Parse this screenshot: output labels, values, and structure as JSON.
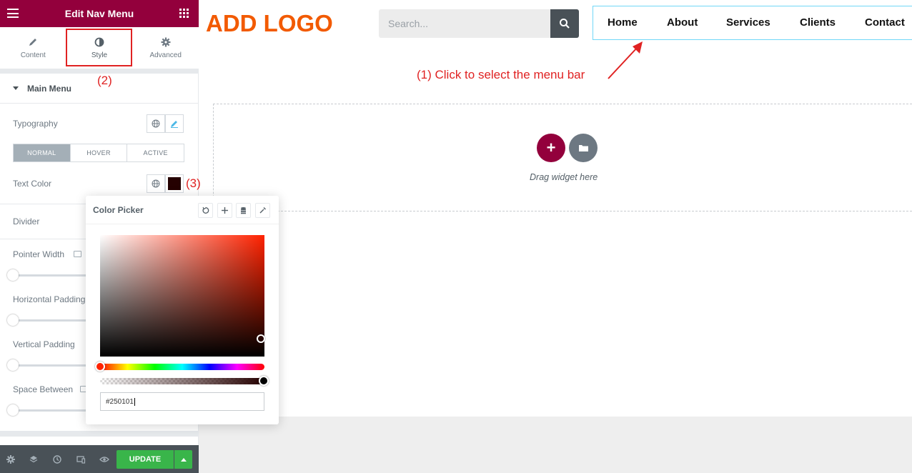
{
  "panel": {
    "title": "Edit Nav Menu",
    "tabs": [
      {
        "label": "Content",
        "icon": "pencil-icon"
      },
      {
        "label": "Style",
        "icon": "half-circle-icon"
      },
      {
        "label": "Advanced",
        "icon": "gear-icon"
      }
    ],
    "section_title": "Main Menu",
    "typography_label": "Typography",
    "states": [
      "NORMAL",
      "HOVER",
      "ACTIVE"
    ],
    "text_color_label": "Text Color",
    "text_color_value": "#250101",
    "divider_label": "Divider",
    "pointer_width_label": "Pointer Width",
    "horizontal_padding_label": "Horizontal Padding",
    "vertical_padding_label": "Vertical Padding",
    "space_between_label": "Space Between",
    "update_label": "UPDATE"
  },
  "annotations": {
    "step1": "(1) Click to select the menu bar",
    "step2": "(2)",
    "step3": "(3)"
  },
  "canvas": {
    "logo": "ADD LOGO",
    "search_placeholder": "Search...",
    "nav": [
      "Home",
      "About",
      "Services",
      "Clients",
      "Contact"
    ],
    "drag_text": "Drag widget here"
  },
  "color_picker": {
    "title": "Color Picker",
    "hex_value": "#250101",
    "hue_color": "#ff2200"
  },
  "colors": {
    "brand": "#93003c",
    "logo": "#f25a00",
    "annotation": "#e02222",
    "update": "#39b54a"
  }
}
